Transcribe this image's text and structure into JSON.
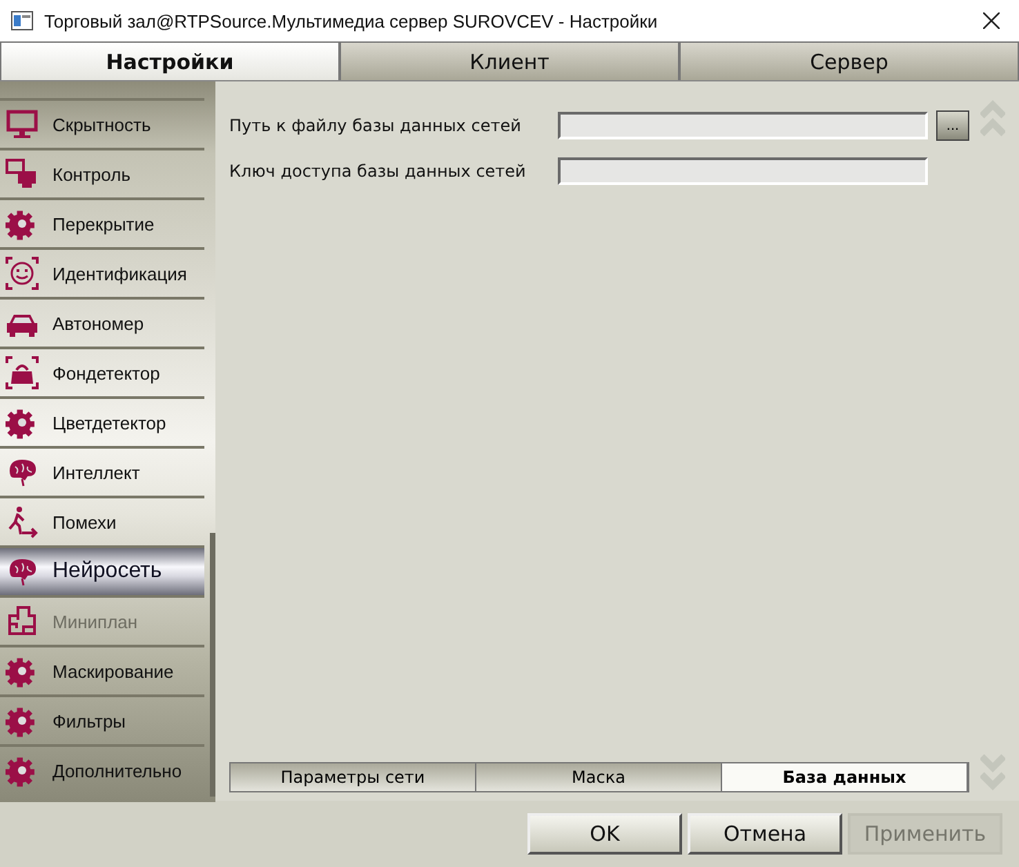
{
  "window": {
    "title": "Торговый зал@RTPSource.Мультимедиа сервер SUROVCEV - Настройки"
  },
  "tabs": [
    {
      "label": "Настройки",
      "selected": true
    },
    {
      "label": "Клиент",
      "selected": false
    },
    {
      "label": "Сервер",
      "selected": false
    }
  ],
  "sidebar": {
    "items": [
      {
        "kind": "monitor",
        "label": "Скрытность",
        "selected": false,
        "disabled": false
      },
      {
        "kind": "computers",
        "label": "Контроль",
        "selected": false,
        "disabled": false
      },
      {
        "kind": "gear",
        "label": "Перекрытие",
        "selected": false,
        "disabled": false
      },
      {
        "kind": "face",
        "label": "Идентификация",
        "selected": false,
        "disabled": false
      },
      {
        "kind": "car",
        "label": "Автономер",
        "selected": false,
        "disabled": false
      },
      {
        "kind": "bag",
        "label": "Фондетектор",
        "selected": false,
        "disabled": false
      },
      {
        "kind": "gear",
        "label": "Цветдетектор",
        "selected": false,
        "disabled": false
      },
      {
        "kind": "brain",
        "label": "Интеллект",
        "selected": false,
        "disabled": false
      },
      {
        "kind": "walker",
        "label": "Помехи",
        "selected": false,
        "disabled": false
      },
      {
        "kind": "brain",
        "label": "Нейросеть",
        "selected": true,
        "disabled": false
      },
      {
        "kind": "plan",
        "label": "Миниплан",
        "selected": false,
        "disabled": true
      },
      {
        "kind": "gear",
        "label": "Маскирование",
        "selected": false,
        "disabled": false
      },
      {
        "kind": "gear",
        "label": "Фильтры",
        "selected": false,
        "disabled": false
      },
      {
        "kind": "gear",
        "label": "Дополнительно",
        "selected": false,
        "disabled": false
      }
    ]
  },
  "fields": [
    {
      "label": "Путь к файлу базы данных сетей",
      "browse": "..."
    },
    {
      "label": "Ключ доступа базы данных сетей"
    }
  ],
  "subtabs": [
    {
      "label": "Параметры сети",
      "selected": false
    },
    {
      "label": "Маска",
      "selected": false
    },
    {
      "label": "База данных",
      "selected": true
    }
  ],
  "buttons": [
    {
      "label": "OK",
      "disabled": false
    },
    {
      "label": "Отмена",
      "disabled": false
    },
    {
      "label": "Применить",
      "disabled": true
    }
  ]
}
